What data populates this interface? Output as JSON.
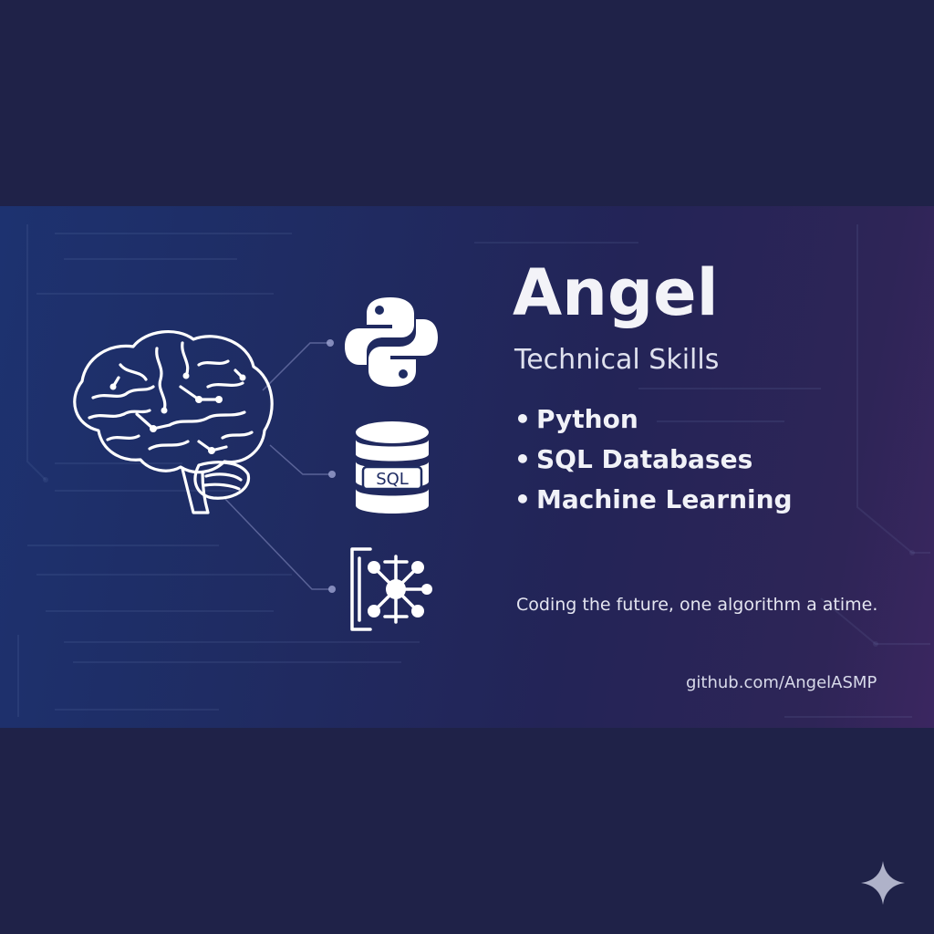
{
  "card": {
    "name": "Angel",
    "subtitle": "Technical Skills",
    "skills": [
      {
        "bullet": "•",
        "label": "Python"
      },
      {
        "bullet": "•",
        "label": "SQL Databases"
      },
      {
        "bullet": "•",
        "label": "Machine Learning"
      }
    ],
    "tagline": "Coding the future, one algorithm a atime.",
    "github": "github.com/AngelASMP"
  },
  "icons": {
    "brain": "brain-circuit-icon",
    "python": "python-logo-icon",
    "sql": "sql-database-icon",
    "sql_label": "SQL",
    "network": "neural-network-icon",
    "sparkle": "sparkle-icon"
  },
  "colors": {
    "page_background": "#1f2248",
    "banner_left": "#1d3270",
    "banner_right": "#3b2660",
    "text_primary": "#f3f3f8",
    "text_secondary": "#dfe1ee",
    "icon_stroke": "#ffffff"
  }
}
